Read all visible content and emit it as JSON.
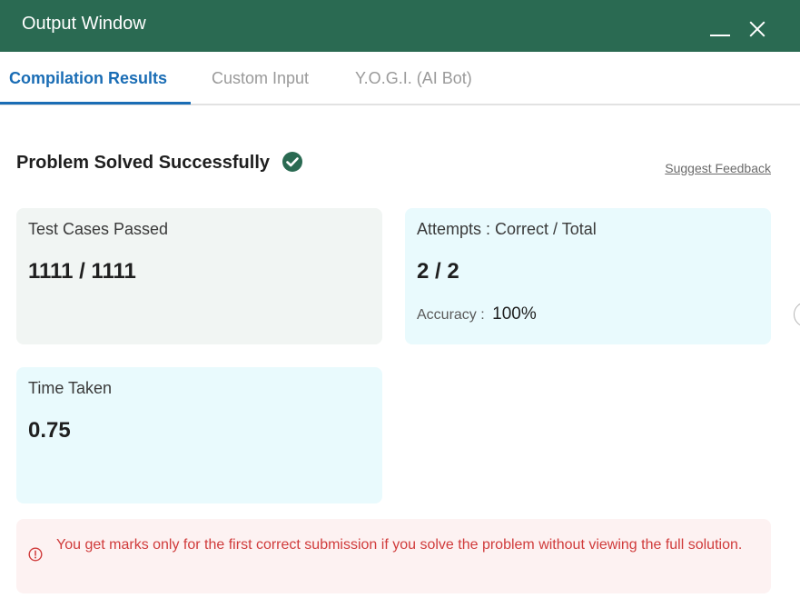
{
  "window": {
    "title": "Output Window"
  },
  "tabs": [
    {
      "label": "Compilation Results",
      "active": true
    },
    {
      "label": "Custom Input",
      "active": false
    },
    {
      "label": "Y.O.G.I. (AI Bot)",
      "active": false
    }
  ],
  "result": {
    "status": "Problem Solved Successfully",
    "feedback_link": "Suggest Feedback"
  },
  "cards": {
    "tests": {
      "label": "Test Cases Passed",
      "value": "1111 / 1111"
    },
    "attempts": {
      "label": "Attempts : Correct / Total",
      "value": "2 / 2",
      "accuracy_label": "Accuracy :",
      "accuracy_value": "100%"
    },
    "time": {
      "label": "Time Taken",
      "value": "0.75"
    }
  },
  "notice": {
    "text": "You get marks only for the first correct submission if you solve the problem without viewing the full solution."
  },
  "icons": {
    "check": "check-circle-icon",
    "warning": "alert-circle-icon",
    "close": "close-icon",
    "minimize": "minimize-icon"
  },
  "colors": {
    "header": "#2a6a52",
    "accent": "#1a6db5",
    "success": "#2a6a52",
    "error": "#d03b3b"
  }
}
